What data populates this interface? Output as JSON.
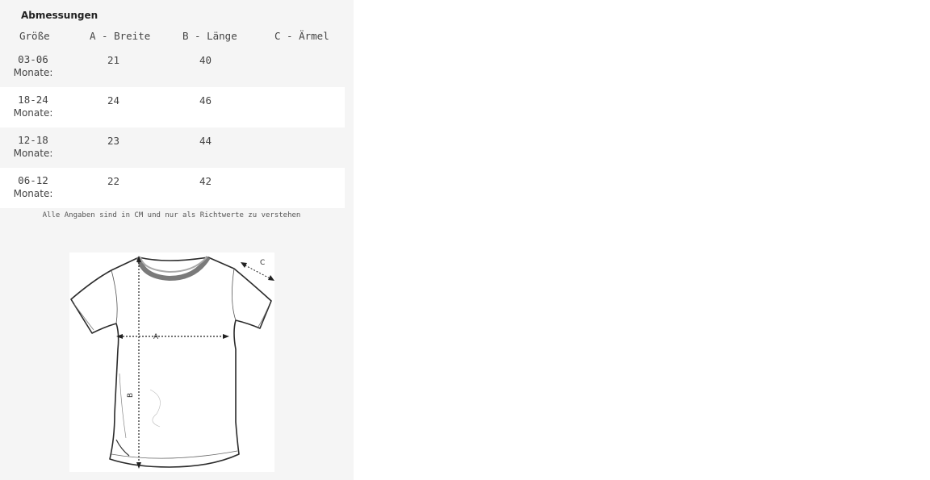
{
  "table": {
    "title": "Abmessungen",
    "headers": {
      "size": "Größe",
      "a": "A - Breite",
      "b": "B - Länge",
      "c": "C - Ärmel"
    },
    "rows": [
      {
        "size_range": "03-06",
        "size_unit": "Monate:",
        "a": "21",
        "b": "40",
        "c": ""
      },
      {
        "size_range": "18-24",
        "size_unit": "Monate:",
        "a": "24",
        "b": "46",
        "c": ""
      },
      {
        "size_range": "12-18",
        "size_unit": "Monate:",
        "a": "23",
        "b": "44",
        "c": ""
      },
      {
        "size_range": "06-12",
        "size_unit": "Monate:",
        "a": "22",
        "b": "42",
        "c": ""
      }
    ],
    "note": "Alle Angaben sind in CM und nur als Richtwerte zu verstehen"
  },
  "diagram": {
    "label_a": "A",
    "label_b": "B",
    "label_c": "C"
  }
}
